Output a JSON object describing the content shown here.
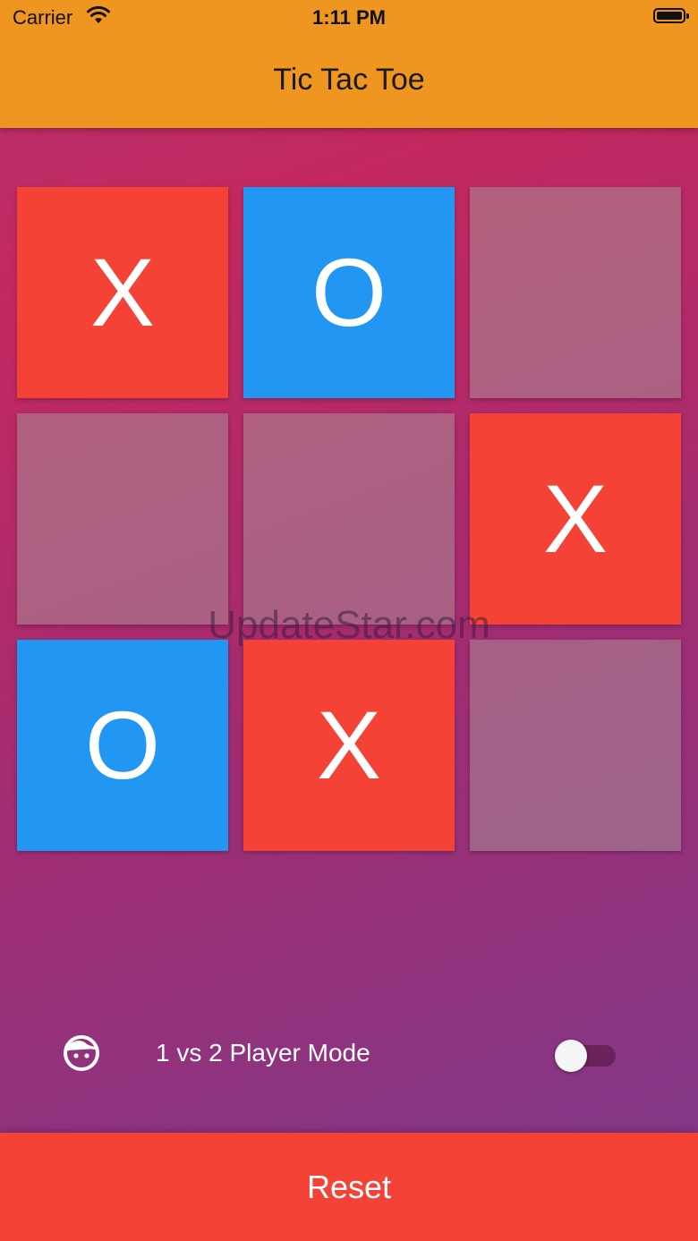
{
  "status_bar": {
    "carrier": "Carrier",
    "time": "1:11 PM"
  },
  "app_bar": {
    "title": "Tic Tac Toe",
    "color": "#ee961f"
  },
  "board": {
    "cells": [
      "X",
      "O",
      "",
      "",
      "",
      "X",
      "O",
      "X",
      ""
    ],
    "x_color": "#f44336",
    "o_color": "#2196f3"
  },
  "watermark": "UpdateStar.com",
  "mode": {
    "label": "1 vs 2 Player Mode",
    "icon": "face-icon",
    "toggle_on": false
  },
  "reset": {
    "label": "Reset",
    "color": "#f44336"
  }
}
